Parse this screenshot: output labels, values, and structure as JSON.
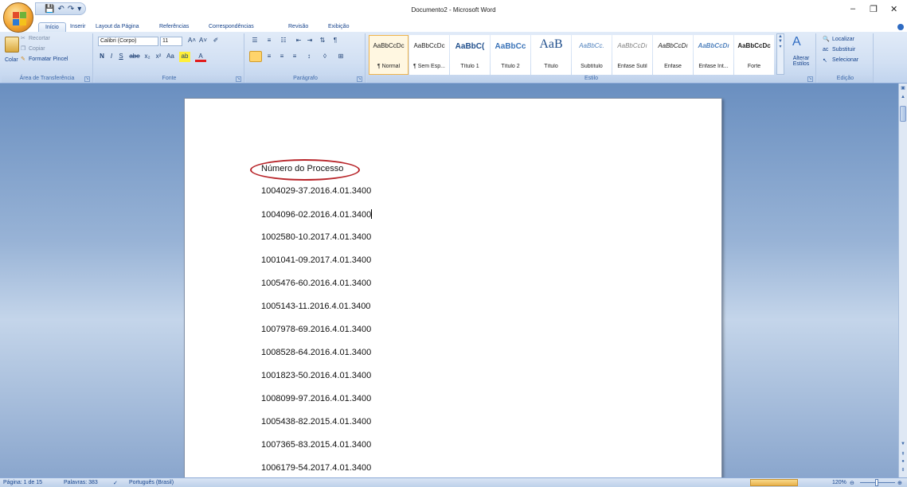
{
  "window": {
    "title": "Documento2 - Microsoft Word",
    "minimize": "–",
    "maximize": "❐",
    "close": "✕"
  },
  "qat": {
    "save": "💾",
    "undo": "↶",
    "redo": "↷",
    "more": "▾"
  },
  "tabs": [
    "Início",
    "Inserir",
    "Layout da Página",
    "Referências",
    "Correspondências",
    "Revisão",
    "Exibição"
  ],
  "ribbon": {
    "clipboard": {
      "label": "Área de Transferência",
      "paste": "Colar",
      "cut": "Recortar",
      "copy": "Copiar",
      "format_painter": "Formatar Pincel"
    },
    "font": {
      "label": "Fonte",
      "font_name": "Calibri (Corpo)",
      "font_size": "11",
      "bold": "N",
      "italic": "I",
      "underline": "S",
      "strike": "abe",
      "subscript": "x₂",
      "superscript": "x²",
      "change_case": "Aa",
      "grow": "A˄",
      "shrink": "A˅",
      "clear": "✐",
      "highlight": "ab",
      "font_color": "A"
    },
    "paragraph": {
      "label": "Parágrafo"
    },
    "styles": {
      "label": "Estilo",
      "items": [
        {
          "sample": "AaBbCcDc",
          "name": "¶ Normal"
        },
        {
          "sample": "AaBbCcDc",
          "name": "¶ Sem Esp..."
        },
        {
          "sample": "AaBbC(",
          "name": "Título 1"
        },
        {
          "sample": "AaBbCc",
          "name": "Título 2"
        },
        {
          "sample": "AaB",
          "name": "Título"
        },
        {
          "sample": "AaBbCc.",
          "name": "Subtítulo"
        },
        {
          "sample": "AaBbCcDı",
          "name": "Ênfase Sutil"
        },
        {
          "sample": "AaBbCcDı",
          "name": "Ênfase"
        },
        {
          "sample": "AaBbCcDı",
          "name": "Ênfase Int..."
        },
        {
          "sample": "AaBbCcDc",
          "name": "Forte"
        }
      ],
      "change_styles": "Alterar Estilos"
    },
    "editing": {
      "label": "Edição",
      "find": "Localizar",
      "replace": "Substituir",
      "select": "Selecionar"
    }
  },
  "document": {
    "heading": "Número do Processo",
    "lines": [
      "1004029-37.2016.4.01.3400",
      "1004096-02.2016.4.01.3400",
      "1002580-10.2017.4.01.3400",
      "1001041-09.2017.4.01.3400",
      "1005476-60.2016.4.01.3400",
      "1005143-11.2016.4.01.3400",
      "1007978-69.2016.4.01.3400",
      "1008528-64.2016.4.01.3400",
      "1001823-50.2016.4.01.3400",
      "1008099-97.2016.4.01.3400",
      "1005438-82.2015.4.01.3400",
      "1007365-83.2015.4.01.3400",
      "1006179-54.2017.4.01.3400"
    ]
  },
  "status": {
    "page": "Página: 1 de 15",
    "words": "Palavras: 383",
    "language": "Português (Brasil)",
    "zoom": "120%"
  },
  "colors": {
    "accent": "#15428b",
    "circle": "#b8262b",
    "ribbon": "#d2e0f3"
  }
}
